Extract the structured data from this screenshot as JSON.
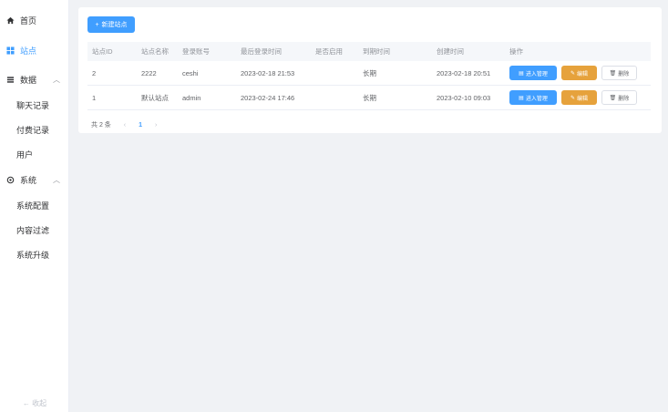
{
  "sidebar": {
    "items": [
      {
        "label": "首页",
        "icon": "home-icon",
        "active": false
      },
      {
        "label": "站点",
        "icon": "grid-icon",
        "active": true
      },
      {
        "label": "数据",
        "icon": "list-icon",
        "group": true
      },
      {
        "label": "聊天记录"
      },
      {
        "label": "付费记录"
      },
      {
        "label": "用户"
      },
      {
        "label": "系统",
        "icon": "gear-icon",
        "group": true
      },
      {
        "label": "系统配置"
      },
      {
        "label": "内容过滤"
      },
      {
        "label": "系统升级"
      }
    ],
    "collapse_label": "← 收起"
  },
  "toolbar": {
    "new_site_label": "新建站点"
  },
  "table": {
    "headers": [
      "站点ID",
      "站点名称",
      "登录账号",
      "最后登录时间",
      "是否启用",
      "到期时间",
      "创建时间",
      "操作"
    ],
    "rows": [
      {
        "id": "2",
        "name": "2222",
        "account": "ceshi",
        "last_login": "2023-02-18 21:53",
        "enabled": false,
        "expire": "长期",
        "created": "2023-02-18 20:51"
      },
      {
        "id": "1",
        "name": "默认站点",
        "account": "admin",
        "last_login": "2023-02-24 17:46",
        "enabled": true,
        "expire": "长期",
        "created": "2023-02-10 09:03"
      }
    ],
    "actions": {
      "enter": "进入管理",
      "edit": "编辑",
      "delete": "删除"
    }
  },
  "pager": {
    "total_text": "共 2 条",
    "current_page": "1"
  },
  "colors": {
    "primary": "#409eff",
    "warning": "#e6a23c",
    "bg": "#f0f2f5"
  }
}
